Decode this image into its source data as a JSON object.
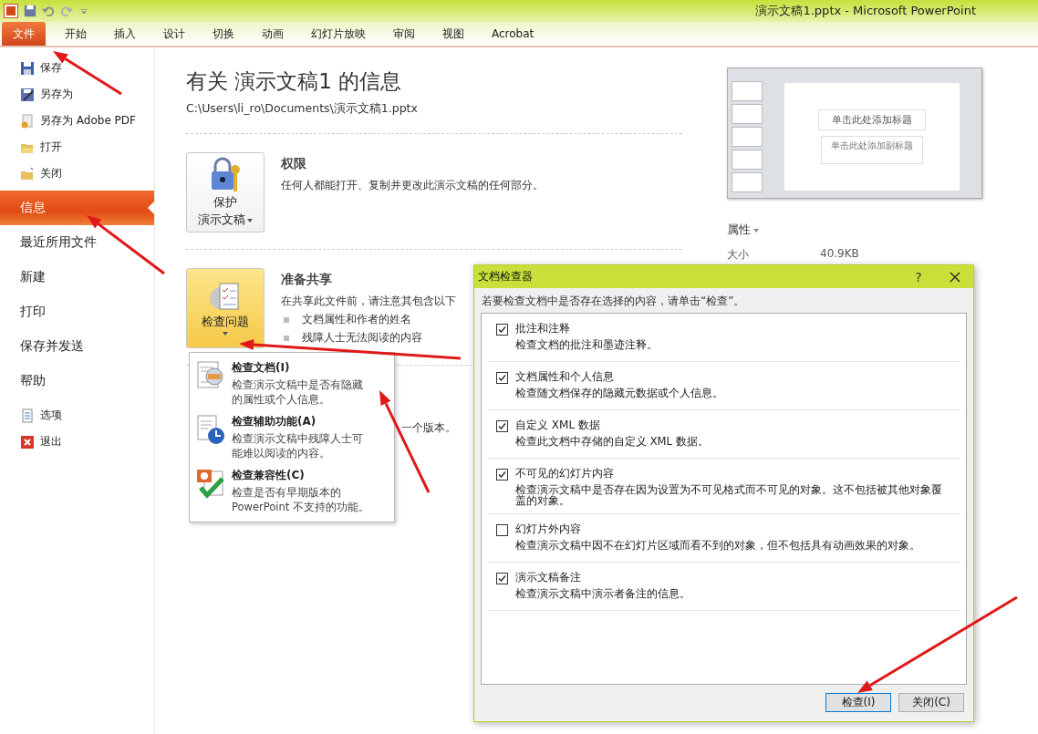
{
  "title_bar": {
    "title": "演示文稿1.pptx  -  Microsoft PowerPoint"
  },
  "ribbon_tabs": [
    {
      "label": "文件",
      "kind": "file"
    },
    {
      "label": "开始",
      "kind": "tab"
    },
    {
      "label": "插入",
      "kind": "tab"
    },
    {
      "label": "设计",
      "kind": "tab"
    },
    {
      "label": "切换",
      "kind": "tab"
    },
    {
      "label": "动画",
      "kind": "tab"
    },
    {
      "label": "幻灯片放映",
      "kind": "tab"
    },
    {
      "label": "审阅",
      "kind": "tab"
    },
    {
      "label": "视图",
      "kind": "tab"
    },
    {
      "label": "Acrobat",
      "kind": "tab"
    }
  ],
  "sidebar": {
    "file_commands": [
      "保存",
      "另存为",
      "另存为 Adobe PDF",
      "打开",
      "关闭"
    ],
    "sections": [
      {
        "label": "信息",
        "selected": true
      },
      {
        "label": "最近所用文件",
        "selected": false
      },
      {
        "label": "新建",
        "selected": false
      },
      {
        "label": "打印",
        "selected": false
      },
      {
        "label": "保存并发送",
        "selected": false
      },
      {
        "label": "帮助",
        "selected": false
      }
    ],
    "app_commands": [
      "选项",
      "退出"
    ]
  },
  "info": {
    "heading": "有关 演示文稿1 的信息",
    "path": "C:\\Users\\li_ro\\Documents\\演示文稿1.pptx",
    "sections": [
      {
        "button_lines": [
          "保护",
          "演示文稿"
        ],
        "highlighted": false,
        "title": "权限",
        "description": "任何人都能打开、复制并更改此演示文稿的任何部分。"
      },
      {
        "button_lines": [
          "检查问题"
        ],
        "highlighted": true,
        "title": "准备共享",
        "description": "在共享此文件前，请注意其包含以下",
        "bullets": [
          "文档属性和作者的姓名",
          "残障人士无法阅读的内容"
        ]
      }
    ],
    "covered_text": "一个版本。"
  },
  "inspect_menu": [
    {
      "title": "检查文档(I)",
      "description": "检查演示文稿中是否有隐藏的属性或个人信息。"
    },
    {
      "title": "检查辅助功能(A)",
      "description": "检查演示文稿中残障人士可能难以阅读的内容。"
    },
    {
      "title": "检查兼容性(C)",
      "description": "检查是否有早期版本的 PowerPoint 不支持的功能。"
    }
  ],
  "preview": {
    "slide_title": "单击此处添加标题",
    "slide_subtitle": "单击此处添加副标题"
  },
  "properties": {
    "heading": "属性",
    "rows": [
      {
        "label": "大小",
        "value": "40.9KB"
      }
    ]
  },
  "dialog": {
    "title": "文档检查器",
    "help": "?",
    "instruction": "若要检查文档中是否存在选择的内容，请单击“检查”。",
    "items": [
      {
        "title": "批注和注释",
        "description": "检查文档的批注和墨迹注释。",
        "checked": true
      },
      {
        "title": "文档属性和个人信息",
        "description": "检查随文档保存的隐藏元数据或个人信息。",
        "checked": true
      },
      {
        "title": "自定义 XML 数据",
        "description": "检查此文档中存储的自定义 XML 数据。",
        "checked": true
      },
      {
        "title": "不可见的幻灯片内容",
        "description": "检查演示文稿中是否存在因为设置为不可见格式而不可见的对象。这不包括被其他对象覆盖的对象。",
        "checked": true
      },
      {
        "title": "幻灯片外内容",
        "description": "检查演示文稿中因不在幻灯片区域而看不到的对象，但不包括具有动画效果的对象。",
        "checked": false
      },
      {
        "title": "演示文稿备注",
        "description": "检查演示文稿中演示者备注的信息。",
        "checked": true
      }
    ],
    "buttons": [
      "检查(I)",
      "关闭(C)"
    ]
  }
}
